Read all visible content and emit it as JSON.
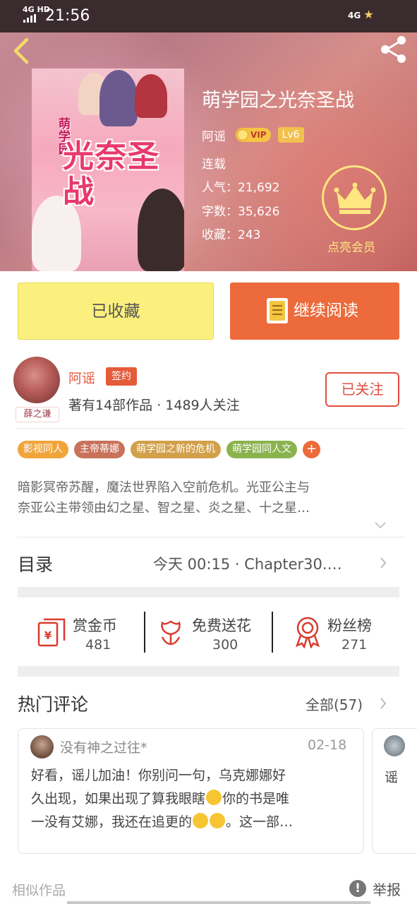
{
  "status_bar": {
    "network": "4G HD",
    "time": "21:56",
    "right": "4G"
  },
  "nav": {
    "back_icon": "chevron-left-icon",
    "share_icon": "share-icon"
  },
  "book": {
    "title": "萌学园之光奈圣战",
    "author": "阿谣",
    "vip_label": "VIP",
    "level": "Lv6",
    "status": "连载",
    "popularity_label": "人气：",
    "popularity": "21,692",
    "words_label": "字数：",
    "words": "35,626",
    "favorites_label": "收藏：",
    "favorites": "243",
    "member_label": "点亮会员",
    "cover_title": "光奈圣战",
    "cover_sub": "萌学园"
  },
  "actions": {
    "collected_label": "已收藏",
    "continue_label": "继续阅读"
  },
  "author_card": {
    "name": "阿谣",
    "signed_label": "签约",
    "avatar_tag": "薛之谦",
    "stats": "著有14部作品 · 1489人关注",
    "follow_label": "已关注"
  },
  "tags": [
    {
      "label": "影视同人",
      "color": "#f0a43a"
    },
    {
      "label": "主帝蒂娜",
      "color": "#c9725a"
    },
    {
      "label": "萌学园之新的危机",
      "color": "#d2a04a"
    },
    {
      "label": "萌学园同人文",
      "color": "#8ab34e"
    }
  ],
  "tag_add": "+",
  "synopsis": {
    "line1": "暗影冥帝苏醒，魔法世界陷入空前危机。光亚公主与",
    "line2": "奈亚公主带领由幻之星、智之星、炎之星、十之星…"
  },
  "catalog": {
    "title": "目录",
    "latest": "今天 00:15 · Chapter30.…"
  },
  "stats": {
    "reward_label": "赏金币",
    "reward_value": "481",
    "flower_label": "免费送花",
    "flower_value": "300",
    "fans_label": "粉丝榜",
    "fans_value": "271"
  },
  "comments": {
    "title": "热门评论",
    "all_label": "全部(57)",
    "items": [
      {
        "user": "没有神之过往*",
        "date": "02-18",
        "line1": "好看，谣儿加油！你别问一句，乌克娜娜好",
        "line2a": "久出现，如果出现了算我眼瞎",
        "line2b": "你的书是唯",
        "line3a": "一没有艾娜，我还在追更的",
        "line3b": "。这一部…"
      },
      {
        "user": "",
        "text": "谣"
      }
    ]
  },
  "footer": {
    "similar_label": "相似作品",
    "report_label": "举报",
    "report_icon": "!"
  },
  "colors": {
    "accent_orange": "#ec6a3b",
    "collected_yellow": "#fbf07e",
    "follow_red": "#e14e3e",
    "member_gold": "#ffe680"
  }
}
